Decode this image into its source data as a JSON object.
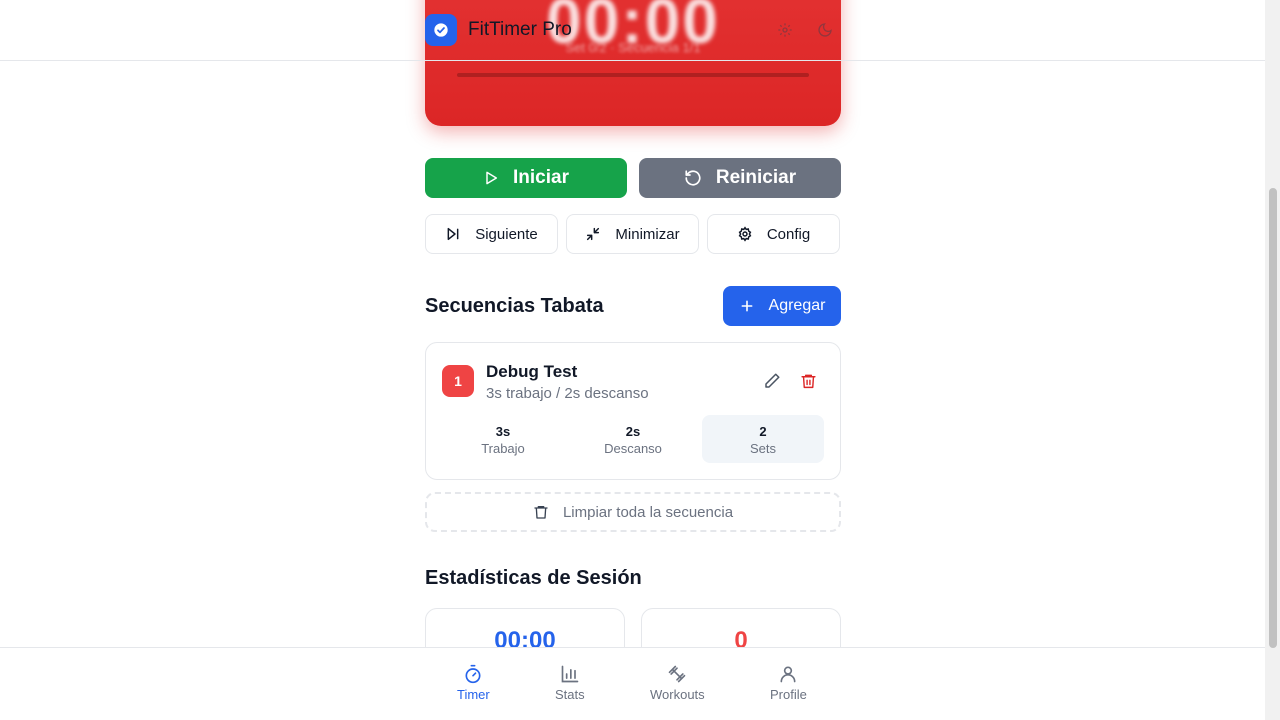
{
  "app": {
    "title": "FitTimer Pro",
    "accent": "#2563eb"
  },
  "timer": {
    "display": "00:00",
    "subtitle": "Set 0/2 · Secuencia 1/1",
    "color": "#dc2626"
  },
  "controls": {
    "start_label": "Iniciar",
    "reset_label": "Reiniciar",
    "next_label": "Siguiente",
    "minimize_label": "Minimizar",
    "config_label": "Config"
  },
  "sequences": {
    "title": "Secuencias Tabata",
    "add_label": "Agregar",
    "items": [
      {
        "number": "1",
        "name": "Debug Test",
        "description": "3s trabajo / 2s descanso",
        "stats": [
          {
            "value": "3s",
            "label": "Trabajo"
          },
          {
            "value": "2s",
            "label": "Descanso"
          },
          {
            "value": "2",
            "label": "Sets"
          }
        ]
      }
    ],
    "clear_label": "Limpiar toda la secuencia"
  },
  "session_stats": {
    "title": "Estadísticas de Sesión",
    "cards": [
      {
        "value": "00:00",
        "color": "#2563eb"
      },
      {
        "value": "0",
        "color": "#ef4444"
      }
    ]
  },
  "nav": {
    "items": [
      {
        "label": "Timer",
        "icon": "timer-icon",
        "active": true
      },
      {
        "label": "Stats",
        "icon": "bar-chart-icon",
        "active": false
      },
      {
        "label": "Workouts",
        "icon": "dumbbell-icon",
        "active": false
      },
      {
        "label": "Profile",
        "icon": "user-icon",
        "active": false
      }
    ]
  }
}
